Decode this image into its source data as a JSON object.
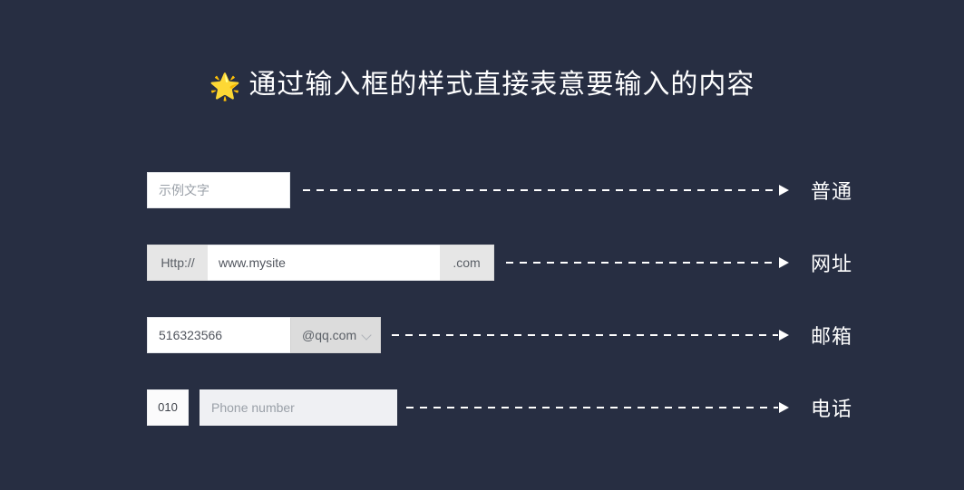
{
  "theme": {
    "background": "#272e42",
    "text_on_dark": "#ffffff",
    "input_bg": "#ffffff",
    "addon_bg": "#e6e6e6",
    "placeholder": "#9aa0a8",
    "value_text": "#51555e"
  },
  "header": {
    "star_icon": "🌟",
    "title": "通过输入框的样式直接表意要输入的内容"
  },
  "rows": [
    {
      "key": "plain",
      "label": "普通",
      "fields": {
        "input_placeholder": "示例文字"
      }
    },
    {
      "key": "url",
      "label": "网址",
      "fields": {
        "prefix": "Http://",
        "input_value": "www.mysite",
        "suffix": ".com"
      }
    },
    {
      "key": "email",
      "label": "邮箱",
      "fields": {
        "input_value": "516323566",
        "select_value": "@qq.com",
        "select_icon": "chevron-down-icon"
      }
    },
    {
      "key": "phone",
      "label": "电话",
      "fields": {
        "area_code": "010",
        "input_placeholder": "Phone number"
      }
    }
  ]
}
